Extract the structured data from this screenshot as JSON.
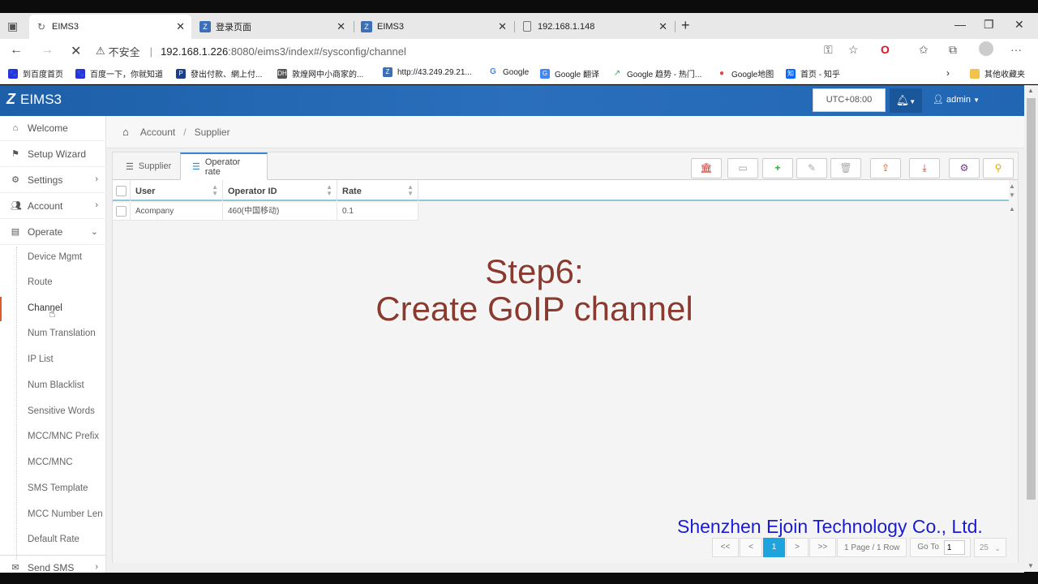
{
  "browser": {
    "tabs": [
      {
        "title": "EIMS3",
        "active": true
      },
      {
        "title": "登录页面",
        "active": false
      },
      {
        "title": "EIMS3",
        "active": false
      },
      {
        "title": "192.168.1.148",
        "active": false
      }
    ],
    "new_tab": "+",
    "address": {
      "security_label": "不安全",
      "separator": "|",
      "host": "192.168.1.226",
      "path": ":8080/eims3/index#/sysconfig/channel"
    },
    "bookmarks": [
      "到百度首页",
      "百度一下，你就知道",
      "發出付款、網上付...",
      "敦煌网中小商家的...",
      "http://43.249.29.21...",
      "Google",
      "Google 翻译",
      "Google 趋势 - 热门...",
      "Google地图",
      "首页 - 知乎",
      "其他收藏夹"
    ]
  },
  "app": {
    "logo": "EIMS3",
    "timezone": "UTC+08:00",
    "user": "admin",
    "colors": {
      "header": "#2166b3",
      "active_page": "#1fa3dc",
      "step_text": "#8b3a30",
      "watermark": "#1a1ad6"
    }
  },
  "sidebar": {
    "items": [
      {
        "label": "Welcome",
        "icon": "home-icon"
      },
      {
        "label": "Setup Wizard",
        "icon": "flag-icon"
      },
      {
        "label": "Settings",
        "icon": "gear-icon"
      },
      {
        "label": "Account",
        "icon": "users-icon"
      },
      {
        "label": "Operate",
        "icon": "operate-icon"
      }
    ],
    "sub_items": [
      "Device Mgmt",
      "Route",
      "Channel",
      "Num Translation",
      "IP List",
      "Num Blacklist",
      "Sensitive Words",
      "MCC/MNC Prefix",
      "MCC/MNC",
      "SMS Template",
      "MCC Number Len",
      "Default Rate"
    ],
    "bottom_item": {
      "label": "Send SMS",
      "icon": "envelope-icon"
    }
  },
  "breadcrumb": {
    "items": [
      "Account",
      "Supplier"
    ],
    "separator": "/"
  },
  "tabs": [
    {
      "label": "Supplier",
      "active": false
    },
    {
      "label": "Operator rate",
      "active": true
    }
  ],
  "table": {
    "columns": [
      "User",
      "Operator ID",
      "Rate"
    ],
    "rows": [
      [
        "Acompany",
        "460(中国移动)",
        "0.1"
      ]
    ]
  },
  "overlay": {
    "line1": "Step6:",
    "line2": "Create GoIP channel",
    "watermark": "Shenzhen Ejoin Technology Co., Ltd."
  },
  "pagination": {
    "first": "<<",
    "prev": "<",
    "current": "1",
    "next": ">",
    "last": ">>",
    "info": "1 Page / 1 Row",
    "goto_label": "Go To",
    "goto_value": "1",
    "page_size": "25"
  }
}
